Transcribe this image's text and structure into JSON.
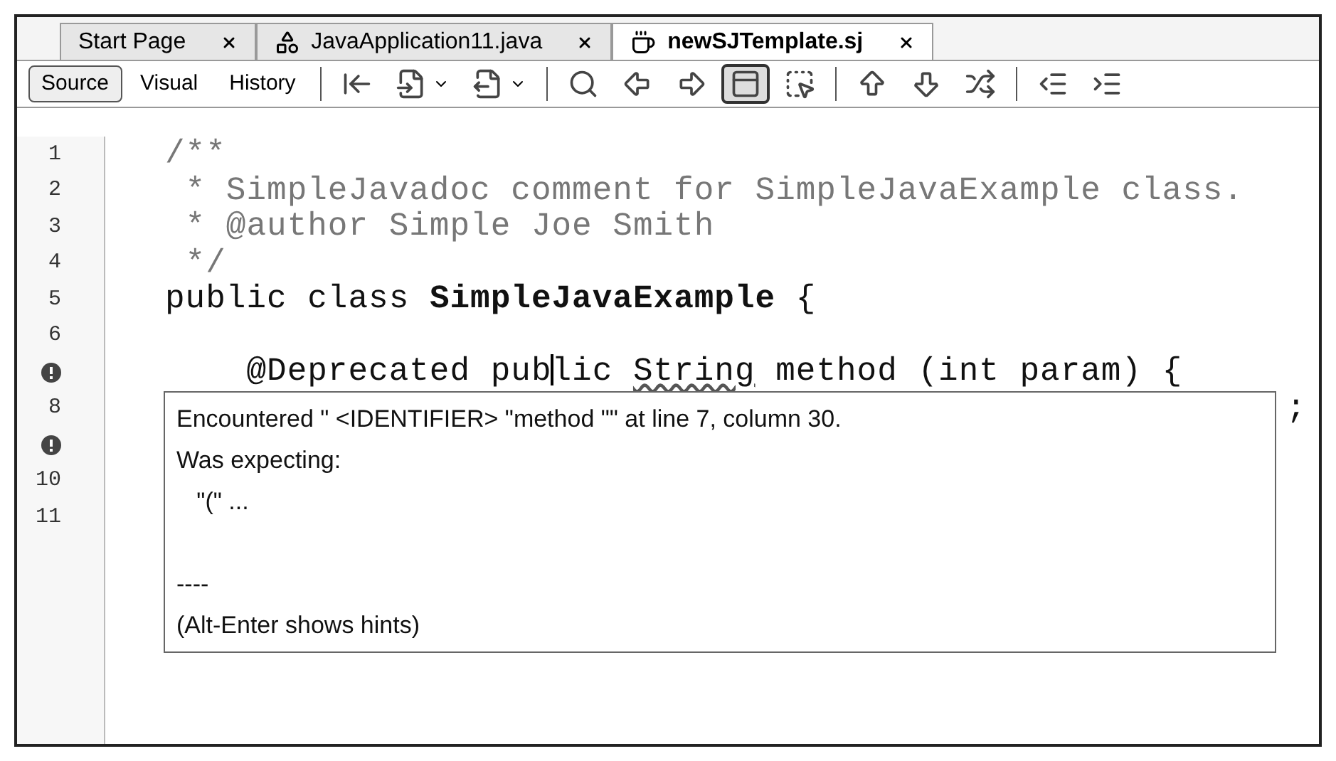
{
  "tabs": [
    {
      "label": "Start Page",
      "kind": "plain",
      "selected": false
    },
    {
      "label": "JavaApplication11.java",
      "kind": "form",
      "selected": false
    },
    {
      "label": "newSJTemplate.sj",
      "kind": "java",
      "selected": true
    }
  ],
  "view_buttons": [
    {
      "label": "Source",
      "selected": true
    },
    {
      "label": "Visual",
      "selected": false
    },
    {
      "label": "History",
      "selected": false
    }
  ],
  "toolbar_icons": [
    {
      "selected": false,
      "dropdown": false
    },
    {
      "selected": false,
      "dropdown": true
    },
    {
      "selected": false,
      "dropdown": true
    },
    {
      "selected": false,
      "dropdown": false
    },
    {
      "selected": false,
      "dropdown": false
    },
    {
      "selected": false,
      "dropdown": false
    },
    {
      "selected": true,
      "dropdown": false
    },
    {
      "selected": false,
      "dropdown": false
    },
    {
      "selected": false,
      "dropdown": false
    },
    {
      "selected": false,
      "dropdown": false
    },
    {
      "selected": false,
      "dropdown": false
    },
    {
      "selected": false,
      "dropdown": false
    },
    {
      "selected": false,
      "dropdown": false
    }
  ],
  "editor": {
    "lines": [
      {
        "error": false,
        "number": "1",
        "kind": "comment",
        "text": "/**"
      },
      {
        "error": false,
        "number": "2",
        "kind": "comment",
        "text": " * SimpleJavadoc comment for SimpleJavaExample class."
      },
      {
        "error": false,
        "number": "3",
        "kind": "comment",
        "text": " * @author Simple Joe Smith"
      },
      {
        "error": false,
        "number": "4",
        "kind": "comment",
        "text": " */"
      },
      {
        "error": false,
        "number": "5",
        "kind": "code",
        "text": "public class **SimpleJavaExample** {"
      },
      {
        "error": false,
        "number": "6",
        "kind": "code"
      },
      {
        "error": true,
        "kind": "caret_line",
        "before": "    @Deprecated pub",
        "after": "lic ",
        "underlined": "String",
        "rest": " method (int param) {"
      },
      {
        "error": false,
        "number": "8",
        "kind": "covered",
        "text": ";"
      },
      {
        "error": true,
        "kind": "code"
      },
      {
        "error": false,
        "number": "10",
        "kind": "code"
      },
      {
        "error": false,
        "number": "11",
        "kind": "code"
      }
    ]
  },
  "tooltip": {
    "message": [
      "Encountered \" <IDENTIFIER> \"method \"\" at line 7, column 30.",
      "Was expecting:",
      "   \"(\" ..."
    ],
    "footer": [
      "----",
      "(Alt-Enter shows hints)"
    ]
  }
}
